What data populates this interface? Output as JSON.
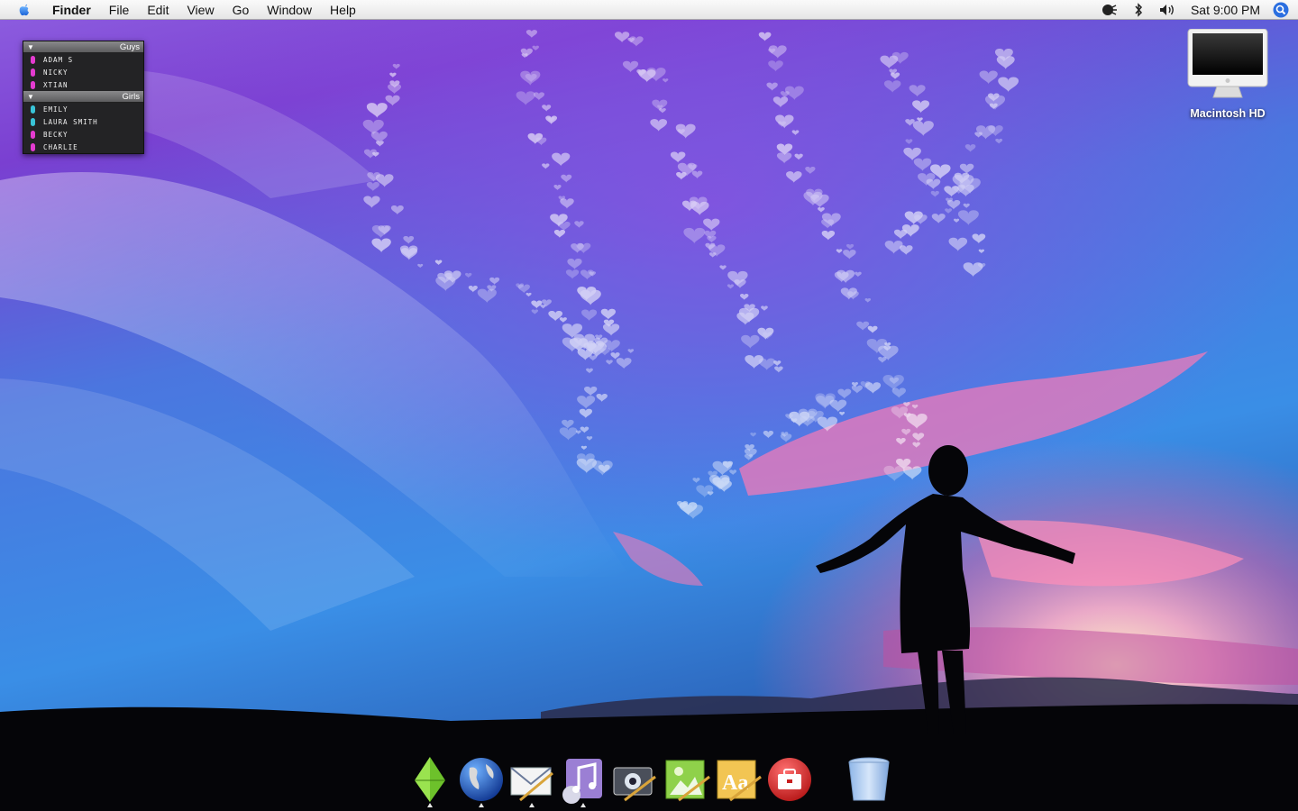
{
  "menubar": {
    "app_name": "Finder",
    "menus": [
      "File",
      "Edit",
      "View",
      "Go",
      "Window",
      "Help"
    ],
    "clock": "Sat 9:00 PM",
    "status_icons": [
      "speech-icon",
      "bluetooth-icon",
      "volume-icon"
    ],
    "spotlight_icon": "spotlight-icon"
  },
  "buddy_list": {
    "groups": [
      {
        "name": "Guys",
        "members": [
          "ADAM S",
          "NICKY",
          "XTIAN"
        ],
        "colors": [
          "#e43bd0",
          "#e43bd0",
          "#e43bd0"
        ]
      },
      {
        "name": "Girls",
        "members": [
          "EMILY",
          "LAURA SMITH",
          "BECKY",
          "CHARLIE"
        ],
        "colors": [
          "#39c4d7",
          "#39c4d7",
          "#e43bd0",
          "#e43bd0"
        ]
      }
    ]
  },
  "desktop": {
    "drive_label": "Macintosh HD"
  },
  "dock": {
    "items": [
      {
        "name": "sims-plumbob-icon",
        "running": true
      },
      {
        "name": "globe-browser-icon",
        "running": true
      },
      {
        "name": "mail-icon",
        "running": true
      },
      {
        "name": "itunes-icon",
        "running": true
      },
      {
        "name": "photo-booth-icon",
        "running": false
      },
      {
        "name": "preview-icon",
        "running": false
      },
      {
        "name": "font-book-icon",
        "running": false
      },
      {
        "name": "toolbox-icon",
        "running": false
      },
      {
        "name": "trash-icon",
        "running": false
      }
    ]
  },
  "colors": {
    "sky_top": "#7a3fd1",
    "sky_mid": "#3f7fe0",
    "sunset_pink": "#f07ab8",
    "sun": "#ffe6a0",
    "ground": "#050508"
  }
}
